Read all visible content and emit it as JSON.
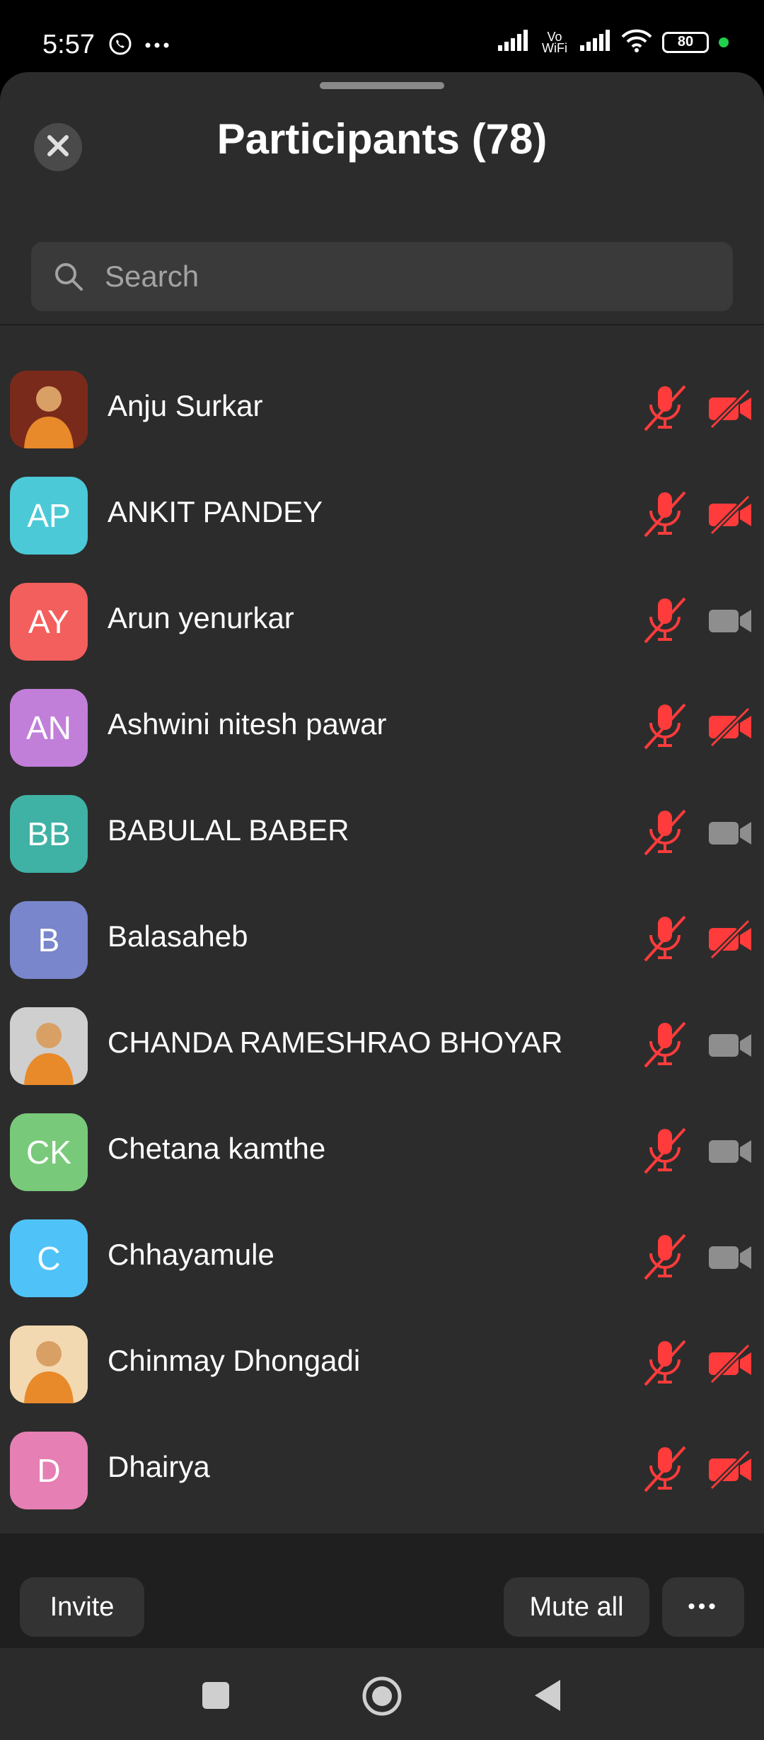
{
  "status": {
    "time": "5:57",
    "battery": "80",
    "vowifi": "Vo WiFi"
  },
  "header": {
    "title": "Participants (78)"
  },
  "search": {
    "placeholder": "Search",
    "value": ""
  },
  "participants": [
    {
      "name": "Anju Surkar",
      "initials": "",
      "avatar_color": "#7a2a1a",
      "photo": true,
      "mic_muted": true,
      "video_off": true
    },
    {
      "name": "ANKIT PANDEY",
      "initials": "AP",
      "avatar_color": "#4bc9d6",
      "photo": false,
      "mic_muted": true,
      "video_off": true
    },
    {
      "name": "Arun yenurkar",
      "initials": "AY",
      "avatar_color": "#f25f5c",
      "photo": false,
      "mic_muted": true,
      "video_off": false
    },
    {
      "name": "Ashwini nitesh pawar",
      "initials": "AN",
      "avatar_color": "#c17fd9",
      "photo": false,
      "mic_muted": true,
      "video_off": true
    },
    {
      "name": "BABULAL BABER",
      "initials": "BB",
      "avatar_color": "#3fb2a5",
      "photo": false,
      "mic_muted": true,
      "video_off": false
    },
    {
      "name": "Balasaheb",
      "initials": "B",
      "avatar_color": "#7986cb",
      "photo": false,
      "mic_muted": true,
      "video_off": true
    },
    {
      "name": "CHANDA RAMESHRAO BHOYAR",
      "initials": "",
      "avatar_color": "#cfcfcf",
      "photo": true,
      "mic_muted": true,
      "video_off": false
    },
    {
      "name": "Chetana kamthe",
      "initials": "CK",
      "avatar_color": "#79c97a",
      "photo": false,
      "mic_muted": true,
      "video_off": false
    },
    {
      "name": "Chhayamule",
      "initials": "C",
      "avatar_color": "#4fc3f7",
      "photo": false,
      "mic_muted": true,
      "video_off": false
    },
    {
      "name": "Chinmay Dhongadi",
      "initials": "",
      "avatar_color": "#f3d9b1",
      "photo": true,
      "mic_muted": true,
      "video_off": true
    },
    {
      "name": "Dhairya",
      "initials": "D",
      "avatar_color": "#e67fb3",
      "photo": false,
      "mic_muted": true,
      "video_off": true
    }
  ],
  "footer": {
    "invite": "Invite",
    "mute_all": "Mute all",
    "more": "•••"
  },
  "colors": {
    "muted_red": "#ff3b3b",
    "video_on_grey": "#8e8e8e",
    "sheet_bg": "#2c2c2c"
  }
}
